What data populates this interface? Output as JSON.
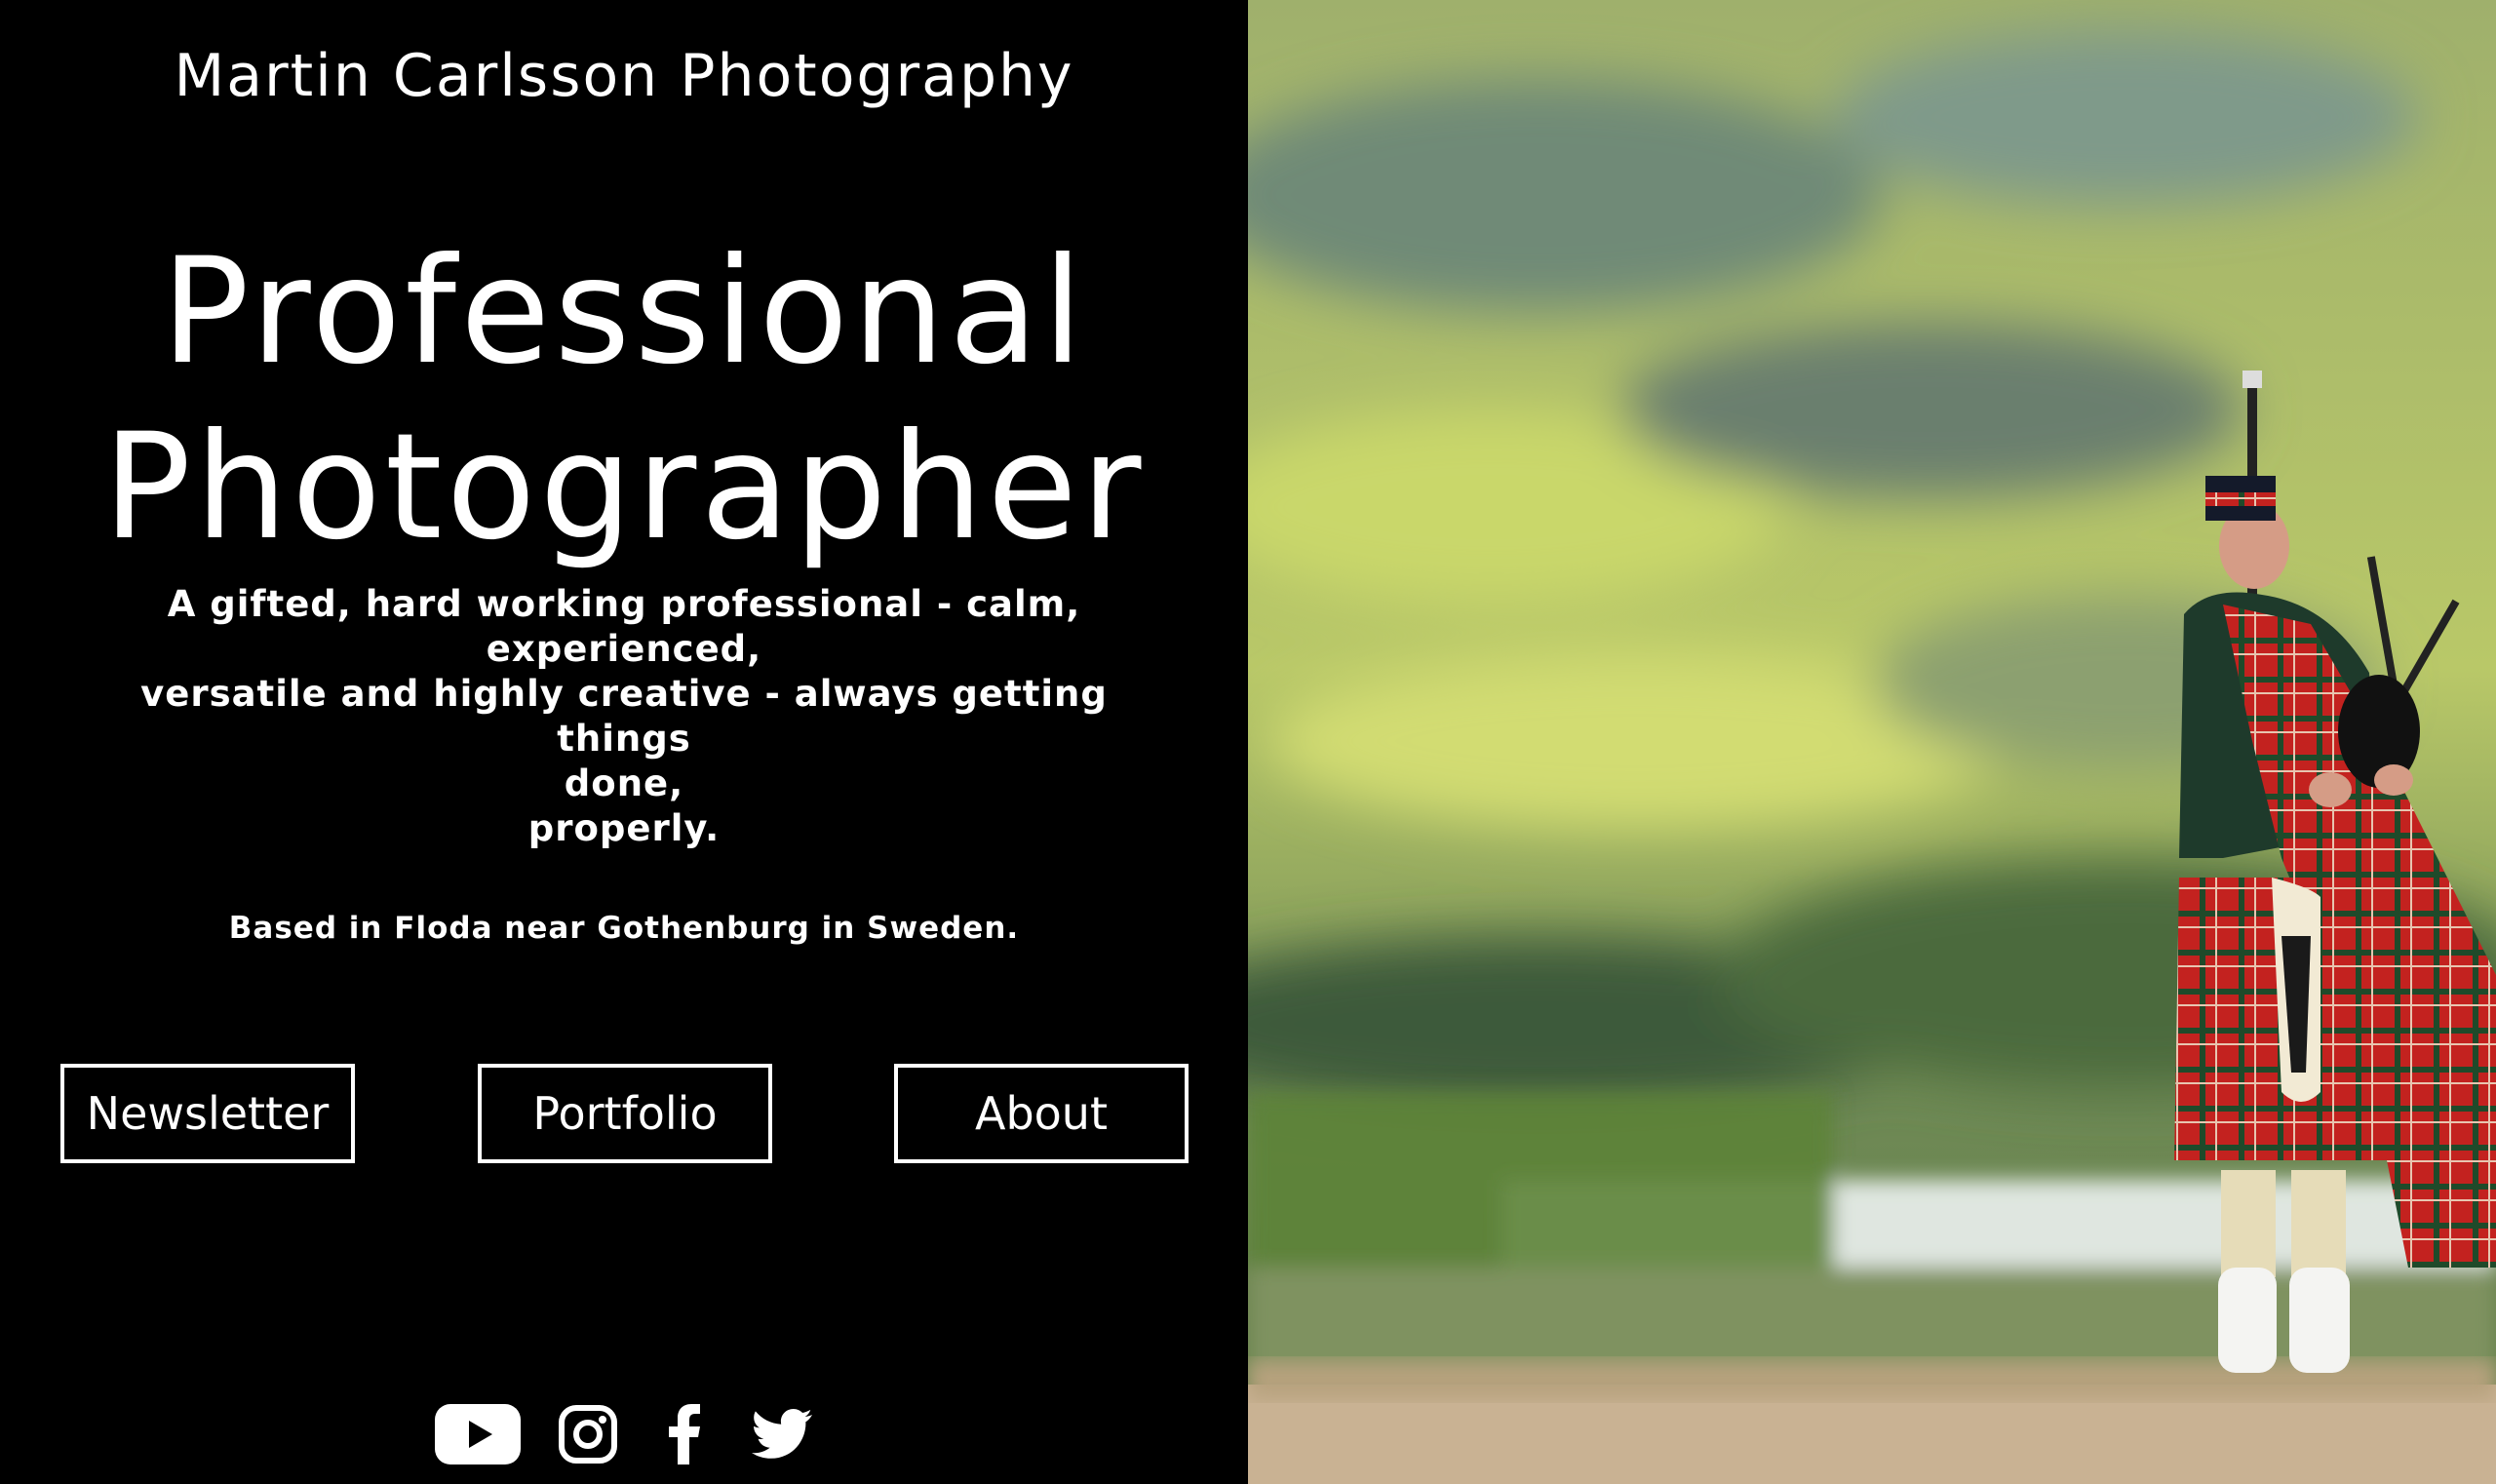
{
  "header": {
    "site_name": "Martin Carlsson Photography"
  },
  "hero": {
    "title_line1": "Professional",
    "title_line2": "Photographer",
    "tagline_lines": [
      "A gifted, hard working professional - calm,",
      "experienced,",
      "versatile and highly creative - always getting things",
      "done,",
      "properly."
    ],
    "location": "Based in Floda near Gothenburg in Sweden."
  },
  "nav": {
    "buttons": [
      {
        "label": "Newsletter"
      },
      {
        "label": "Portfolio"
      },
      {
        "label": "About"
      }
    ]
  },
  "social": {
    "icons": [
      "youtube-icon",
      "instagram-icon",
      "facebook-icon",
      "twitter-icon"
    ]
  },
  "colors": {
    "background": "#000000",
    "text": "#ffffff"
  }
}
